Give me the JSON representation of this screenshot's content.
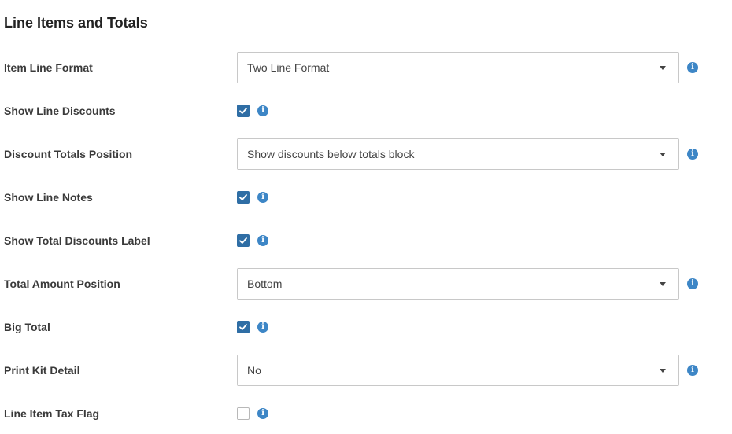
{
  "section": {
    "title": "Line Items and Totals"
  },
  "icons": {
    "info": "i",
    "info_color": "#3d86c6",
    "checkbox_checked_color": "#2f6ea5"
  },
  "fields": {
    "item_line_format": {
      "label": "Item Line Format",
      "type": "select",
      "value": "Two Line Format"
    },
    "show_line_discounts": {
      "label": "Show Line Discounts",
      "type": "checkbox",
      "checked": true
    },
    "discount_totals_position": {
      "label": "Discount Totals Position",
      "type": "select",
      "value": "Show discounts below totals block"
    },
    "show_line_notes": {
      "label": "Show Line Notes",
      "type": "checkbox",
      "checked": true
    },
    "show_total_discounts_label": {
      "label": "Show Total Discounts Label",
      "type": "checkbox",
      "checked": true
    },
    "total_amount_position": {
      "label": "Total Amount Position",
      "type": "select",
      "value": "Bottom"
    },
    "big_total": {
      "label": "Big Total",
      "type": "checkbox",
      "checked": true
    },
    "print_kit_detail": {
      "label": "Print Kit Detail",
      "type": "select",
      "value": "No"
    },
    "line_item_tax_flag": {
      "label": "Line Item Tax Flag",
      "type": "checkbox",
      "checked": false
    }
  }
}
